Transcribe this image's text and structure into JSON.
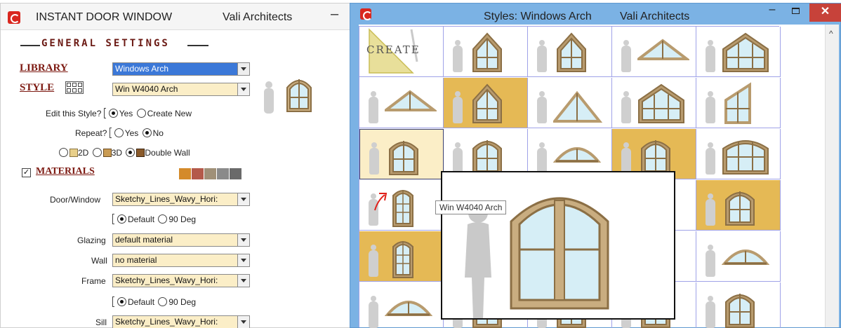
{
  "left_window": {
    "title": "INSTANT DOOR WINDOW",
    "company": "Vali Architects",
    "minimize": "–",
    "general_settings": "GENERAL SETTINGS",
    "library_label": "LIBRARY",
    "library_value": "Windows Arch",
    "style_label": "STYLE",
    "style_value": "Win W4040 Arch",
    "edit_style_label": "Edit this Style?",
    "edit_yes": "Yes",
    "edit_create": "Create New",
    "repeat_label": "Repeat?",
    "repeat_yes": "Yes",
    "repeat_no": "No",
    "opt_2d": "2D",
    "opt_3d": "3D",
    "opt_double": "Double Wall",
    "materials_label": "MATERIALS",
    "door_window_label": "Door/Window",
    "door_window_value": "Sketchy_Lines_Wavy_Hori:",
    "default_label": "Default",
    "deg_label": "90 Deg",
    "glazing_label": "Glazing",
    "glazing_value": "default material",
    "wall_label": "Wall",
    "wall_value": "no material",
    "frame_label": "Frame",
    "frame_value": "Sketchy_Lines_Wavy_Hori:",
    "sill_label": "Sill",
    "sill_value": "Sketchy_Lines_Wavy_Hori:",
    "swatch_colors": [
      "#d48a2a",
      "#b45a4a",
      "#a09078",
      "#8a8a8a",
      "#6a6a6a"
    ]
  },
  "right_window": {
    "title": "Styles: Windows Arch",
    "company": "Vali Architects",
    "minimize": "–",
    "close": "✕",
    "scroll_up": "^",
    "create_label": "CREATE",
    "tooltip": "Win W4040 Arch"
  },
  "colors": {
    "frame": "#b89b6e",
    "frame_dark": "#8b6f45",
    "glass": "#d6eef6",
    "grid_line": "#9fa2e8",
    "yellow_bg": "#e5b955",
    "title_bar_right": "#7bb2e4"
  }
}
